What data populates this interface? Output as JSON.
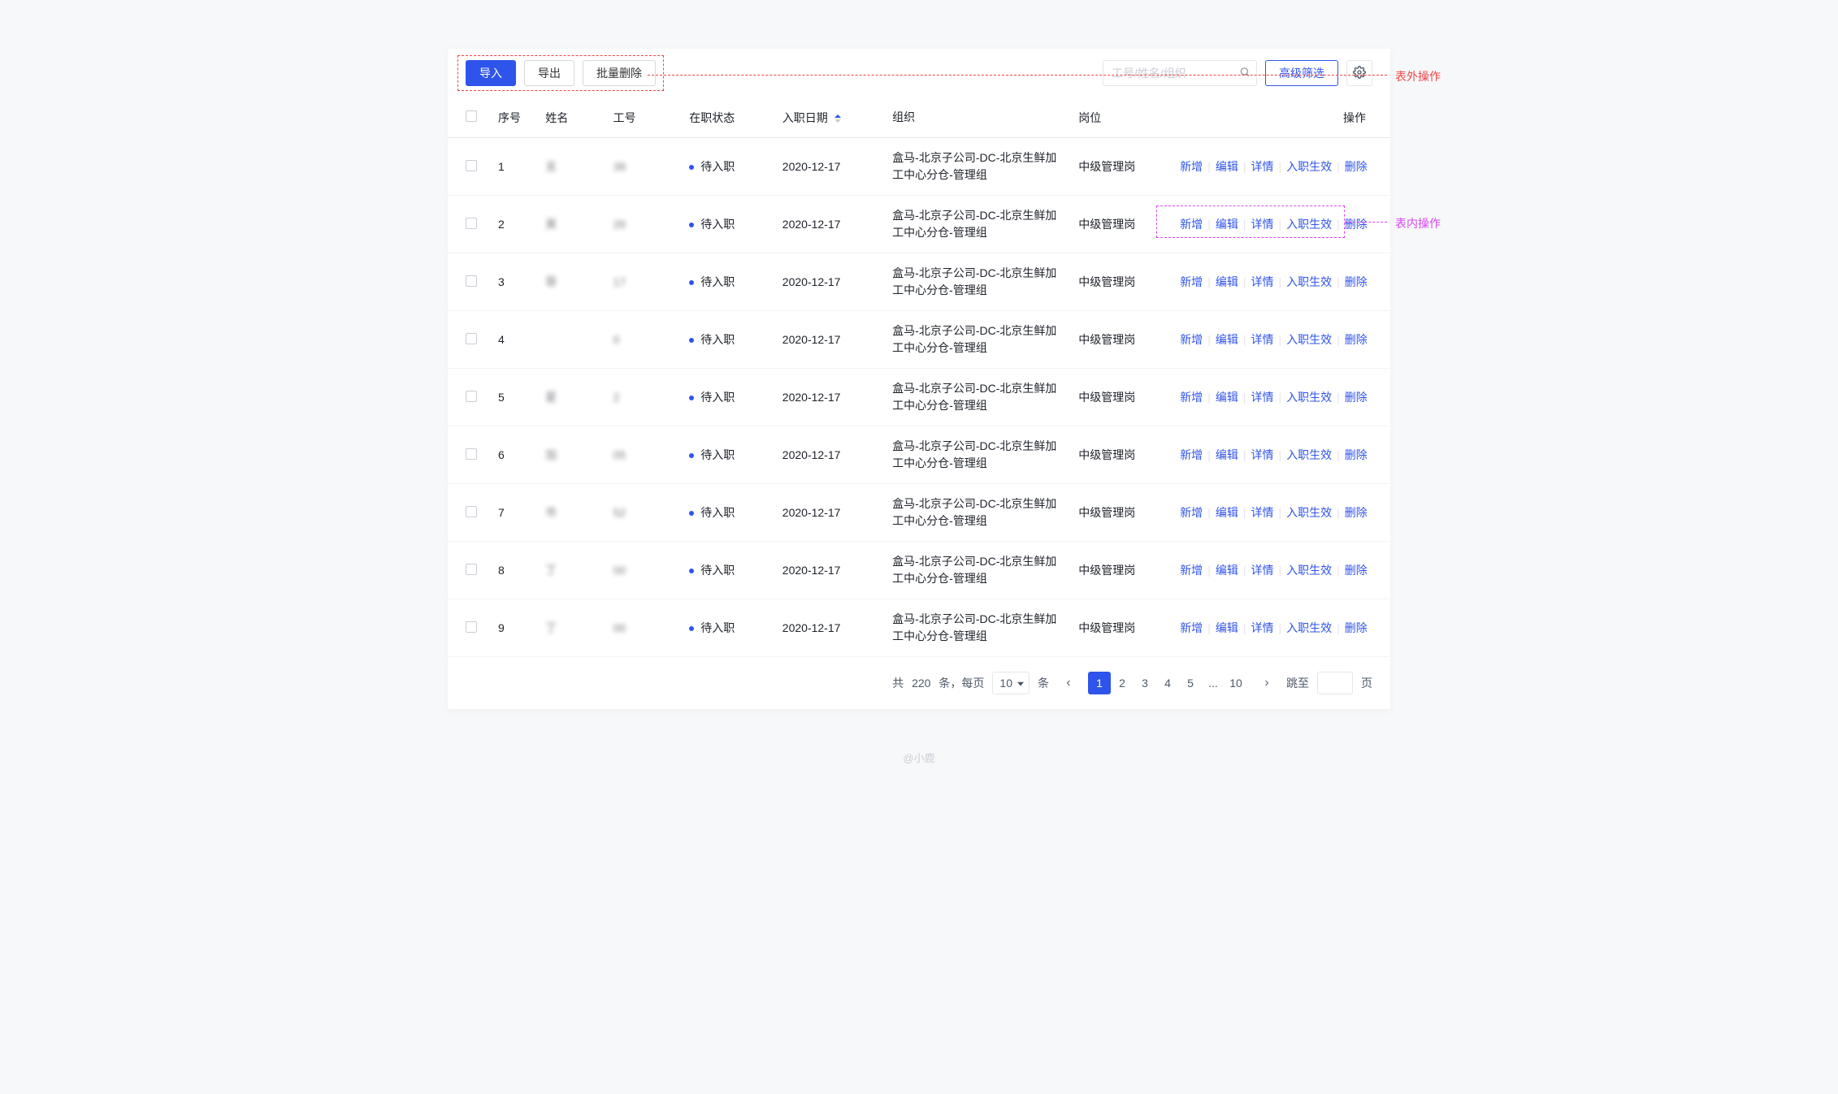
{
  "toolbar": {
    "import_label": "导入",
    "export_label": "导出",
    "batch_delete_label": "批量删除",
    "search_placeholder": "工号/姓名/组织",
    "advanced_filter_label": "高级筛选"
  },
  "annotations": {
    "outer_label": "表外操作",
    "inner_label": "表内操作"
  },
  "columns": {
    "seq": "序号",
    "name": "姓名",
    "emp_id": "工号",
    "status": "在职状态",
    "join_date": "入职日期",
    "org": "组织",
    "position": "岗位",
    "action": "操作"
  },
  "row_actions": {
    "add": "新增",
    "edit": "编辑",
    "detail": "详情",
    "activate": "入职生效",
    "delete": "删除"
  },
  "rows": [
    {
      "seq": "1",
      "name": "支",
      "emp_id": "38",
      "status": "待入职",
      "date": "2020-12-17",
      "org": "盒马-北京子公司-DC-北京生鲜加工中心分仓-管理组",
      "pos": "中级管理岗"
    },
    {
      "seq": "2",
      "name": "昊",
      "emp_id": "26",
      "status": "待入职",
      "date": "2020-12-17",
      "org": "盒马-北京子公司-DC-北京生鲜加工中心分仓-管理组",
      "pos": "中级管理岗"
    },
    {
      "seq": "3",
      "name": "菲",
      "emp_id": "17",
      "status": "待入职",
      "date": "2020-12-17",
      "org": "盒马-北京子公司-DC-北京生鲜加工中心分仓-管理组",
      "pos": "中级管理岗"
    },
    {
      "seq": "4",
      "name": "",
      "emp_id": "0",
      "status": "待入职",
      "date": "2020-12-17",
      "org": "盒马-北京子公司-DC-北京生鲜加工中心分仓-管理组",
      "pos": "中级管理岗"
    },
    {
      "seq": "5",
      "name": "星",
      "emp_id": "2",
      "status": "待入职",
      "date": "2020-12-17",
      "org": "盒马-北京子公司-DC-北京生鲜加工中心分仓-管理组",
      "pos": "中级管理岗"
    },
    {
      "seq": "6",
      "name": "加",
      "emp_id": "05",
      "status": "待入职",
      "date": "2020-12-17",
      "org": "盒马-北京子公司-DC-北京生鲜加工中心分仓-管理组",
      "pos": "中级管理岗"
    },
    {
      "seq": "7",
      "name": "巿",
      "emp_id": "52",
      "status": "待入职",
      "date": "2020-12-17",
      "org": "盒马-北京子公司-DC-北京生鲜加工中心分仓-管理组",
      "pos": "中级管理岗"
    },
    {
      "seq": "8",
      "name": "丁",
      "emp_id": "00",
      "status": "待入职",
      "date": "2020-12-17",
      "org": "盒马-北京子公司-DC-北京生鲜加工中心分仓-管理组",
      "pos": "中级管理岗"
    },
    {
      "seq": "9",
      "name": "丁",
      "emp_id": "00",
      "status": "待入职",
      "date": "2020-12-17",
      "org": "盒马-北京子公司-DC-北京生鲜加工中心分仓-管理组",
      "pos": "中级管理岗"
    }
  ],
  "pagination": {
    "total_prefix": "共",
    "total_count": "220",
    "total_suffix": "条，每页",
    "page_size": "10",
    "page_size_suffix": "条",
    "pages": [
      "1",
      "2",
      "3",
      "4",
      "5",
      "...",
      "10"
    ],
    "active_page": "1",
    "jump_label": "跳至",
    "jump_suffix": "页"
  },
  "footer": "@小鹿"
}
